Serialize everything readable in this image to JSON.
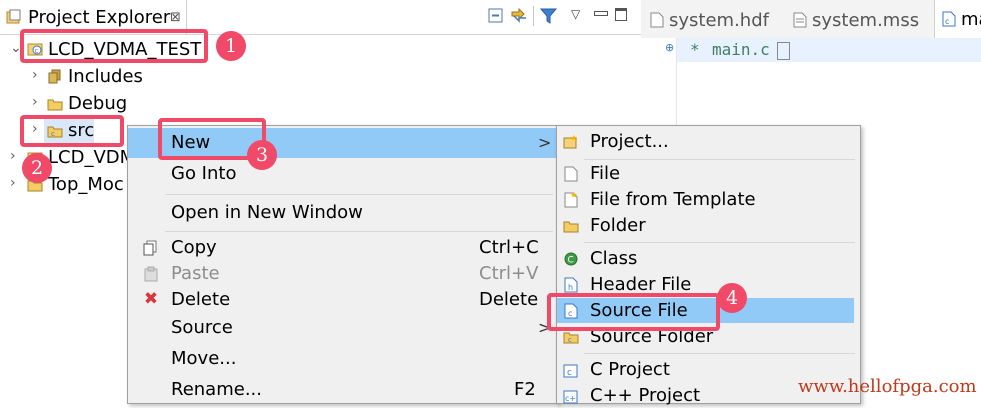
{
  "explorer": {
    "title": "Project Explorer",
    "close_glyph": "⊠",
    "tree": [
      {
        "label": "LCD_VDMA_TEST"
      },
      {
        "label": "Includes"
      },
      {
        "label": "Debug"
      },
      {
        "label": "src"
      },
      {
        "label": "LCD_VDM"
      },
      {
        "label": "Top_Moc"
      }
    ]
  },
  "editor": {
    "tabs": [
      "system.hdf",
      "system.mss",
      "ma"
    ],
    "line_marker": "*",
    "line_text": "main.c"
  },
  "context_menu": {
    "items": [
      {
        "label": "New"
      },
      {
        "label": "Go Into"
      },
      {
        "label": "Open in New Window"
      },
      {
        "label": "Copy",
        "shortcut": "Ctrl+C"
      },
      {
        "label": "Paste",
        "shortcut": "Ctrl+V"
      },
      {
        "label": "Delete",
        "shortcut": "Delete"
      },
      {
        "label": "Source"
      },
      {
        "label": "Move..."
      },
      {
        "label": "Rename...",
        "shortcut": "F2"
      }
    ],
    "submenu_arrow": ">"
  },
  "submenu": {
    "items": [
      {
        "label": "Project..."
      },
      {
        "label": "File"
      },
      {
        "label": "File from Template"
      },
      {
        "label": "Folder"
      },
      {
        "label": "Class"
      },
      {
        "label": "Header File"
      },
      {
        "label": "Source File"
      },
      {
        "label": "Source Folder"
      },
      {
        "label": "C Project"
      },
      {
        "label": "C++ Project"
      }
    ]
  },
  "annotations": {
    "badges": [
      "1",
      "2",
      "3",
      "4"
    ]
  },
  "watermark": "www.hellofpga.com",
  "colors": {
    "highlight": "#91c9f7",
    "annotation_red": "#f04a68",
    "watermark": "#c0391b"
  }
}
